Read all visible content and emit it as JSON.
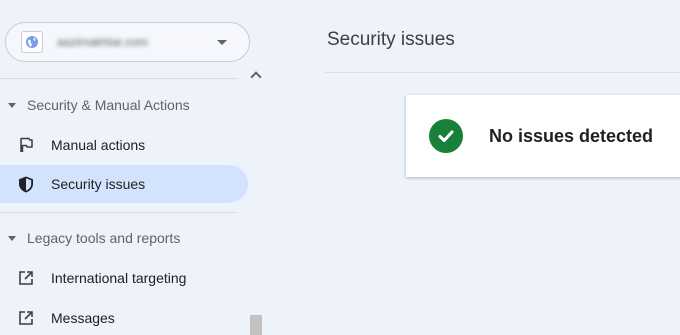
{
  "header": {
    "property": "aazimakhtar.com"
  },
  "sidebar": {
    "sections": [
      {
        "label": "Security & Manual Actions",
        "items": [
          {
            "label": "Manual actions",
            "icon": "flag-icon"
          },
          {
            "label": "Security issues",
            "icon": "shield-icon",
            "active": true
          }
        ]
      },
      {
        "label": "Legacy tools and reports",
        "items": [
          {
            "label": "International targeting",
            "icon": "external-link-icon"
          },
          {
            "label": "Messages",
            "icon": "external-link-icon"
          }
        ]
      }
    ]
  },
  "main": {
    "title": "Security issues",
    "status": {
      "text": "No issues detected",
      "icon": "check-circle-icon",
      "color": "#188038"
    }
  },
  "colors": {
    "active_bg": "#d3e3fd",
    "background": "#eef2fb"
  }
}
